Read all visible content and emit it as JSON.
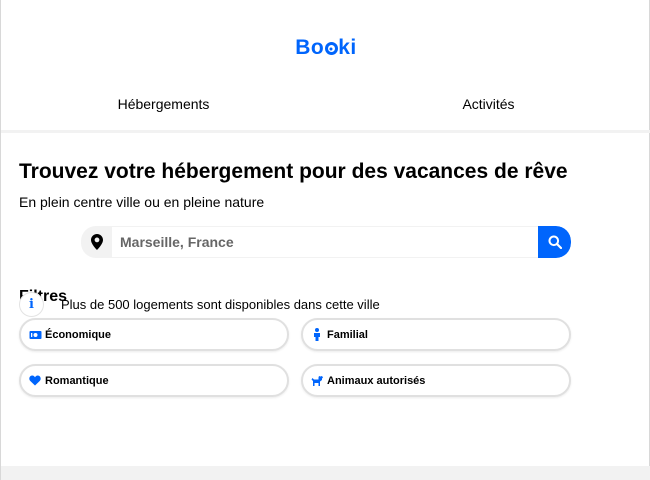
{
  "brand": {
    "logo_text_a": "Bo",
    "logo_text_b": "ki"
  },
  "nav": {
    "items": [
      {
        "label": "Hébergements"
      },
      {
        "label": "Activités"
      }
    ]
  },
  "hero": {
    "title": "Trouvez votre hébergement pour des vacances de rêve",
    "subtitle": "En plein centre ville ou en pleine nature"
  },
  "search": {
    "value": "Marseille, France",
    "icons": {
      "location": "map-pin-icon",
      "submit": "search-icon"
    }
  },
  "filters": {
    "title": "Filtres",
    "items": [
      {
        "label": "Économique",
        "icon": "money-icon"
      },
      {
        "label": "Familial",
        "icon": "person-icon"
      },
      {
        "label": "Romantique",
        "icon": "heart-icon"
      },
      {
        "label": "Animaux autorisés",
        "icon": "dog-icon"
      }
    ]
  },
  "info": {
    "icon_text": "i",
    "text": "Plus de 500 logements sont disponibles dans cette ville"
  },
  "colors": {
    "accent": "#0065fc",
    "light_gray": "#f2f2f2",
    "chip_border": "#e0e0e0"
  }
}
